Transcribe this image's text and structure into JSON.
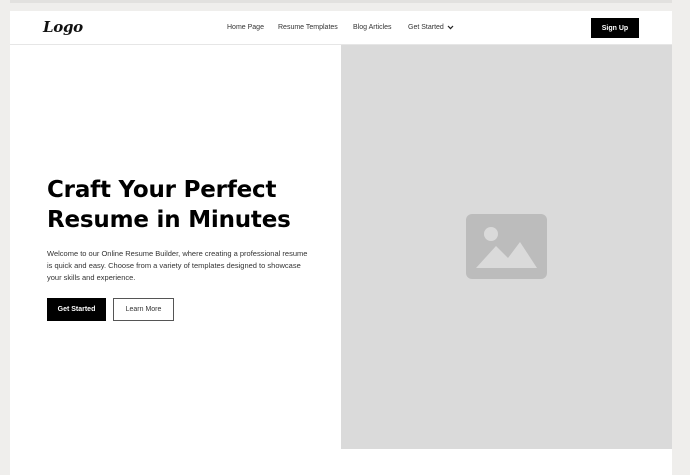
{
  "header": {
    "logo": "Logo",
    "nav": [
      {
        "label": "Home Page"
      },
      {
        "label": "Resume Templates"
      },
      {
        "label": "Blog Articles"
      },
      {
        "label": "Get Started"
      }
    ],
    "signup_label": "Sign Up"
  },
  "hero": {
    "title": "Craft Your Perfect Resume in Minutes",
    "description": "Welcome to our Online Resume Builder, where creating a professional resume is quick and easy. Choose from a variety of templates designed to showcase your skills and experience.",
    "primary_button": "Get Started",
    "secondary_button": "Learn More",
    "image_icon": "image-placeholder-icon"
  },
  "colors": {
    "primary": "#000000",
    "background": "#ffffff",
    "placeholder_bg": "#dadada",
    "placeholder_icon": "#bcbcbc"
  }
}
